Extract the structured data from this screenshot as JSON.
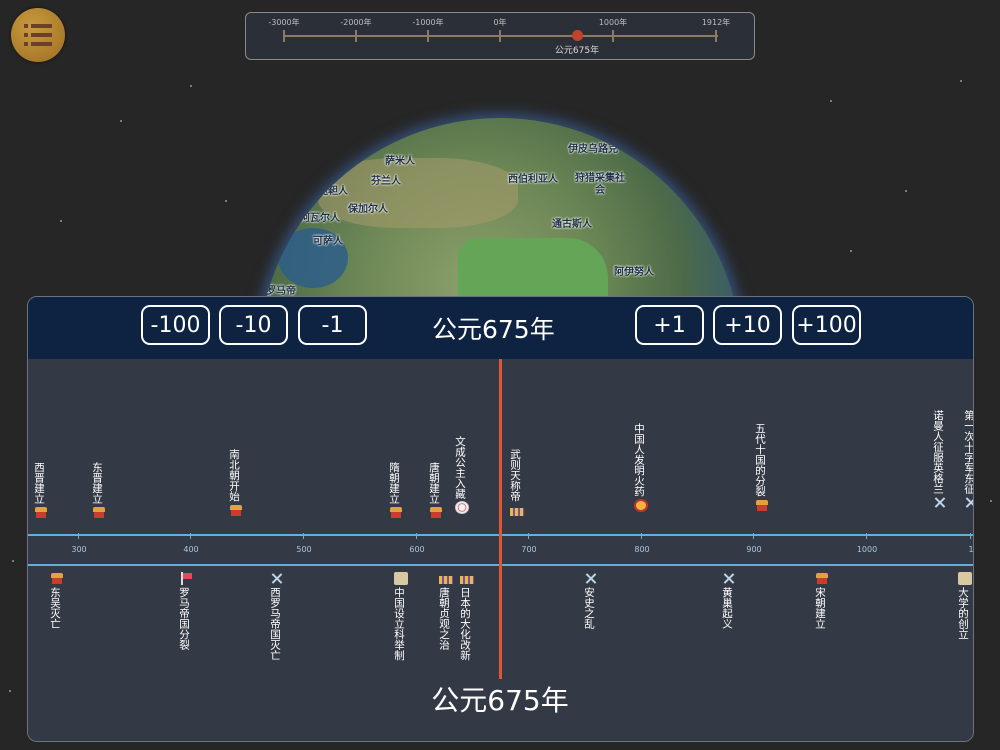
{
  "overview": {
    "tick_labels": [
      "-3000年",
      "-2000年",
      "-1000年",
      "0年",
      "1000年",
      "1912年"
    ],
    "current_label": "公元675年"
  },
  "globe_labels": [
    "萨米人",
    "芬兰人",
    "鞑靼人",
    "保加尔人",
    "阿瓦尔人",
    "可萨人",
    "伊皮乌路克",
    "西伯利亚人",
    "狩猎采集社会",
    "通古斯人",
    "阿伊努人",
    "罗马帝"
  ],
  "controls": {
    "minus100": "-100",
    "minus10": "-10",
    "minus1": "-1",
    "plus1": "+1",
    "plus10": "+10",
    "plus100": "+100",
    "header_year": "公元675年"
  },
  "axis": {
    "labels": [
      "300",
      "400",
      "500",
      "600",
      "700",
      "800",
      "900",
      "1000",
      "1"
    ]
  },
  "events_top": [
    {
      "text": "西晋建立",
      "icon": "palace"
    },
    {
      "text": "东晋建立",
      "icon": "palace"
    },
    {
      "text": "南北朝开始",
      "icon": "palace"
    },
    {
      "text": "隋朝建立",
      "icon": "palace"
    },
    {
      "text": "唐朝建立",
      "icon": "palace"
    },
    {
      "text": "文成公主入藏",
      "icon": "bowl"
    },
    {
      "text": "武则天称帝",
      "icon": "people"
    },
    {
      "text": "中国人发明火药",
      "icon": "bomb"
    },
    {
      "text": "五代十国的分裂",
      "icon": "palace"
    },
    {
      "text": "诺曼人征服英格兰",
      "icon": "swords"
    },
    {
      "text": "第一次十字军东征",
      "icon": "swords"
    }
  ],
  "events_bottom": [
    {
      "text": "东吴灭亡",
      "icon": "palace"
    },
    {
      "text": "罗马帝国分裂",
      "icon": "flag"
    },
    {
      "text": "西罗马帝国灭亡",
      "icon": "swords"
    },
    {
      "text": "中国设立科举制",
      "icon": "scroll"
    },
    {
      "text": "唐朝贞观之治",
      "icon": "people"
    },
    {
      "text": "日本的大化改新",
      "icon": "people"
    },
    {
      "text": "安史之乱",
      "icon": "swords"
    },
    {
      "text": "黄巢起义",
      "icon": "swords"
    },
    {
      "text": "宋朝建立",
      "icon": "palace"
    },
    {
      "text": "大学的创立",
      "icon": "scroll"
    }
  ],
  "current_year": "公元675年"
}
